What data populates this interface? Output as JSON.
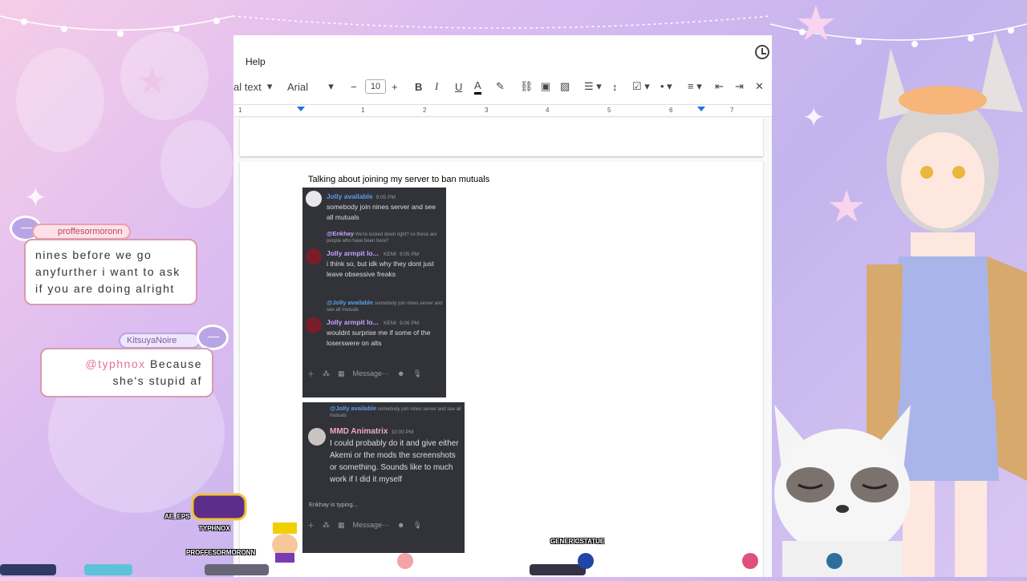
{
  "doc": {
    "menu": {
      "help_label": "Help"
    },
    "toolbar": {
      "style_label": "al text",
      "font_label": "Arial",
      "font_size": "10",
      "bold": "B",
      "italic": "I",
      "underline": "U",
      "text_color": "A"
    },
    "ruler": [
      "1",
      "1",
      "2",
      "3",
      "4",
      "5",
      "6",
      "7"
    ],
    "body_text": "Talking about joining my server to ban mutuals"
  },
  "discord1": {
    "messages": [
      {
        "name": "Jolly available",
        "time": "9:05 PM",
        "text": "somebody join nines server and see all mutuals",
        "color": "#5a9dea"
      },
      {
        "reply_name": "@Enkhay",
        "reply_text": "We're locked down right? so these are people who have been here?",
        "name": "Jolly armpit lo...",
        "badge": "KEMI",
        "time": "9:05 PM",
        "text": "i think so, but idk why they dont just leave obsessive freaks",
        "color": "#c9a0ff"
      },
      {
        "reply_name": "@Jolly available",
        "reply_text": "somebody join nines server and see all mutuals",
        "name": "Jolly armpit lo...",
        "badge": "KEMI",
        "time": "9:06 PM",
        "text": "wouldnt surprise me if some of the loserswere on alts",
        "color": "#c9a0ff"
      }
    ],
    "input_placeholder": "Message···"
  },
  "discord2": {
    "reply_name": "@Jolly available",
    "reply_text": "somebody join nines server and see all mutuals",
    "name": "MMD Animatrix",
    "time": "10:00 PM",
    "text": "I could probably do it and give either Akemi or the mods the screenshots or something. Sounds like to much work if I did it myself",
    "typing": "Enkhay is typing...",
    "input_placeholder": "Message···"
  },
  "chat": [
    {
      "user": "proffesormoronn",
      "message": "nines before we go anyfurther i want to ask if you are doing alright"
    },
    {
      "user": "KitsuyaNoire",
      "mention": "@typhnox",
      "message": "Because she's stupid af"
    }
  ],
  "name_tags": [
    "AE_EPS",
    "TYPHNOX",
    "PROFFESORMORONN",
    "GENERICSTATUE"
  ],
  "colors": {
    "accent": "#1a73e8",
    "discord_bg": "#313338",
    "chat_border": "#d99ab0"
  }
}
